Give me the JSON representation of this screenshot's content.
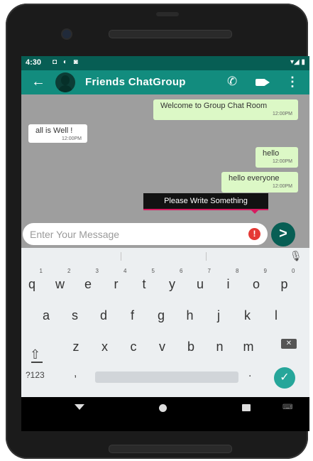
{
  "status_bar": {
    "time": "4:30",
    "left_icons": "◘ ◐ ◙",
    "right_icons": "▾◢ ▮"
  },
  "app_bar": {
    "title": "Friends ChatGroup",
    "back_icon": "←",
    "call_icon": "✆",
    "menu_icon": "⋮"
  },
  "messages": [
    {
      "text": "Welcome to Group Chat Room",
      "time": "12:00PM",
      "direction": "out"
    },
    {
      "text": "all is Well !",
      "time": "12:00PM",
      "direction": "in"
    },
    {
      "text": "hello",
      "time": "12:00PM",
      "direction": "out"
    },
    {
      "text": "hello everyone",
      "time": "12:00PM",
      "direction": "out"
    }
  ],
  "toast": {
    "text": "Please Write Something"
  },
  "composer": {
    "placeholder": "Enter Your Message",
    "value": "",
    "error_icon": "!",
    "send_icon": ">"
  },
  "keyboard": {
    "row1": [
      "q",
      "w",
      "e",
      "r",
      "t",
      "y",
      "u",
      "i",
      "o",
      "p"
    ],
    "row1_hints": [
      "1",
      "2",
      "3",
      "4",
      "5",
      "6",
      "7",
      "8",
      "9",
      "0"
    ],
    "row2": [
      "a",
      "s",
      "d",
      "f",
      "g",
      "h",
      "j",
      "k",
      "l"
    ],
    "row3": [
      "z",
      "x",
      "c",
      "v",
      "b",
      "n",
      "m"
    ],
    "shift_icon": "⇧",
    "backspace_icon": "✕",
    "symbols_label": "?123",
    "comma_label": ",",
    "period_label": ".",
    "enter_icon": "✓",
    "mic_icon": "🎙"
  },
  "colors": {
    "primary_dark": "#075e54",
    "primary": "#128c7e",
    "outgoing_bubble": "#dcf8c6",
    "chat_bg": "#9e9e9e",
    "error": "#e53935",
    "toast_accent": "#d81b60",
    "enter_key": "#26a69a"
  }
}
